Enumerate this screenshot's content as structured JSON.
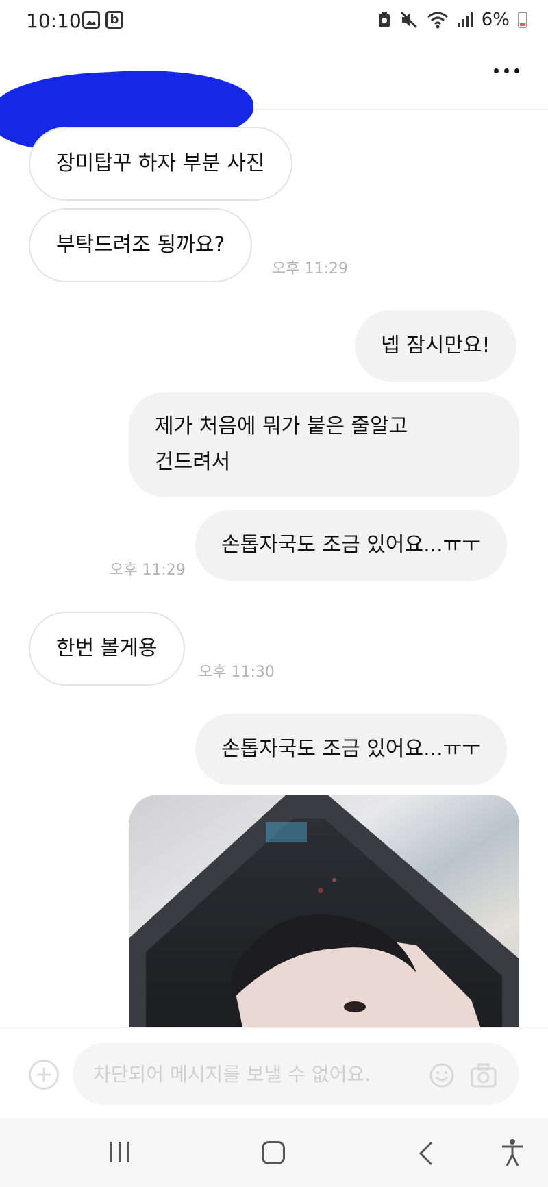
{
  "status_bar": {
    "time": "10:10",
    "battery_percent": "6%",
    "icons": [
      "gallery-icon",
      "b-app-icon",
      "battery-saver-icon",
      "mute-icon",
      "wifi-icon",
      "signal-icon",
      "battery-icon"
    ]
  },
  "header": {
    "title_redacted": true,
    "menu_icon": "more-icon"
  },
  "messages": [
    {
      "direction": "in",
      "text": "장미탑꾸 하자 부분 사진"
    },
    {
      "direction": "in",
      "text": "부탁드려조 됭까요?",
      "time": "오후 11:29"
    },
    {
      "direction": "out",
      "text": "넵 잠시만요!"
    },
    {
      "direction": "out",
      "lines": [
        "제가 처음에 뭐가 붙은 줄알고",
        "건드려서"
      ]
    },
    {
      "direction": "out",
      "text": "손톱자국도 조금 있어요...ㅠㅜ",
      "time": "오후 11:29"
    },
    {
      "direction": "in",
      "text": "한번 볼게용",
      "time": "오후 11:30"
    },
    {
      "direction": "out",
      "text": "손톱자국도 조금 있어요...ㅠㅜ"
    },
    {
      "direction": "out",
      "type": "photo"
    }
  ],
  "composer": {
    "placeholder": "차단되어 메시지를 보낼 수 없어요.",
    "icons": [
      "plus-icon",
      "emoji-icon",
      "camera-icon"
    ]
  },
  "colors": {
    "incoming_bubble_border": "#e4e4e4",
    "outgoing_bubble_bg": "#f2f2f2",
    "timestamp": "#b5b5b5",
    "redaction": "#1428e6"
  }
}
